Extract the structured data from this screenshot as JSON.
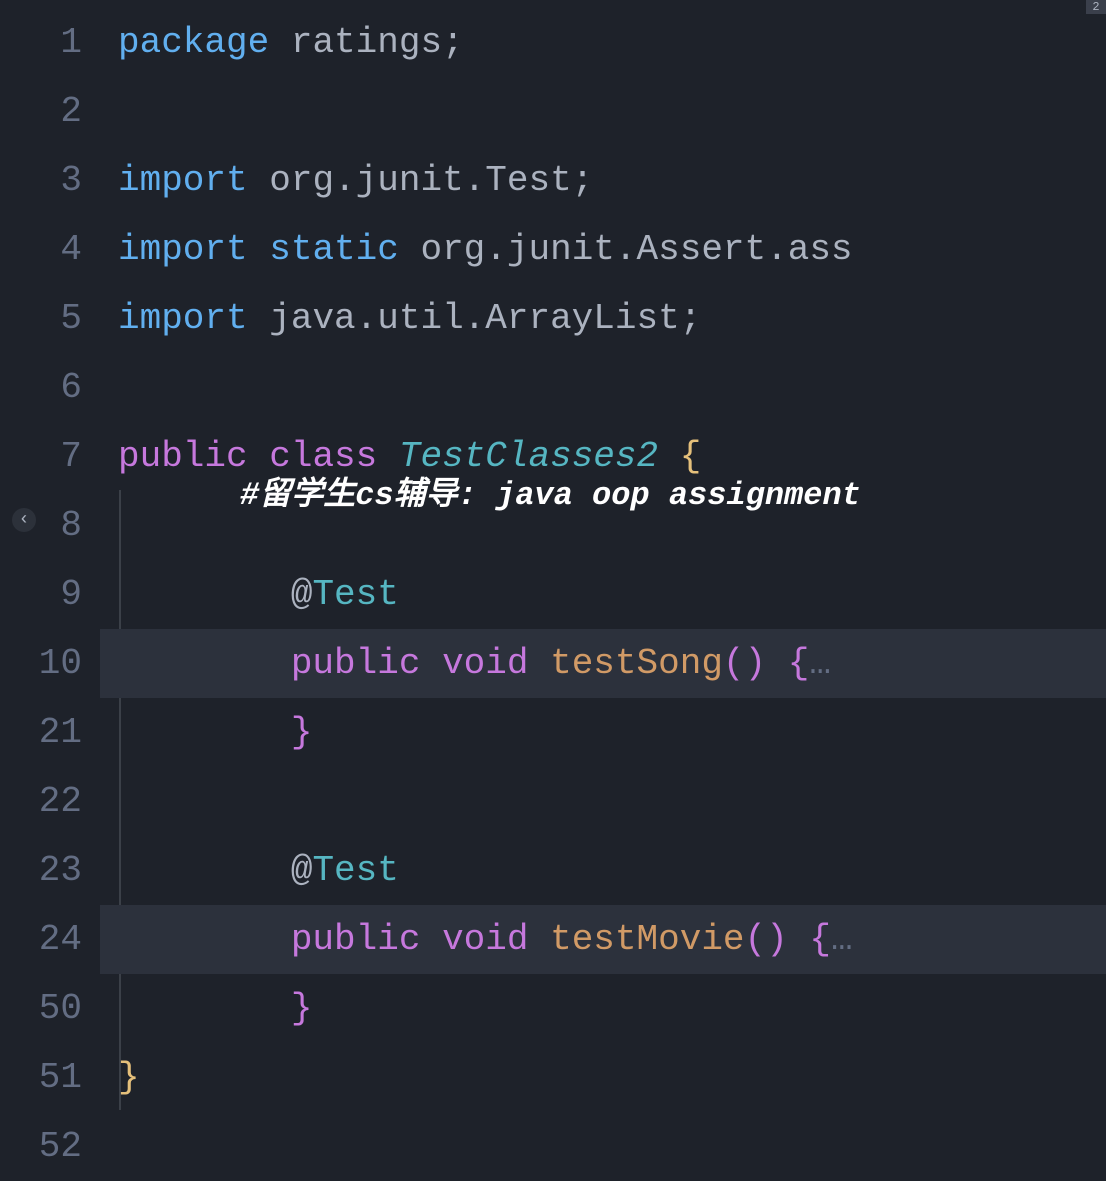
{
  "lines": [
    {
      "num": "1",
      "tokens": [
        {
          "t": "package",
          "c": "kw-blue"
        },
        {
          "t": " ",
          "c": "ident"
        },
        {
          "t": "ratings",
          "c": "ident"
        },
        {
          "t": ";",
          "c": "punct"
        }
      ]
    },
    {
      "num": "2",
      "tokens": []
    },
    {
      "num": "3",
      "tokens": [
        {
          "t": "import",
          "c": "kw-blue"
        },
        {
          "t": " ",
          "c": "ident"
        },
        {
          "t": "org.junit.Test",
          "c": "ident"
        },
        {
          "t": ";",
          "c": "punct"
        }
      ]
    },
    {
      "num": "4",
      "tokens": [
        {
          "t": "import",
          "c": "kw-blue"
        },
        {
          "t": " ",
          "c": "ident"
        },
        {
          "t": "static",
          "c": "kw-blue"
        },
        {
          "t": " ",
          "c": "ident"
        },
        {
          "t": "org.junit.Assert.ass",
          "c": "ident"
        }
      ]
    },
    {
      "num": "5",
      "tokens": [
        {
          "t": "import",
          "c": "kw-blue"
        },
        {
          "t": " ",
          "c": "ident"
        },
        {
          "t": "java.util.ArrayList",
          "c": "ident"
        },
        {
          "t": ";",
          "c": "punct"
        }
      ]
    },
    {
      "num": "6",
      "tokens": []
    },
    {
      "num": "7",
      "tokens": [
        {
          "t": "public",
          "c": "kw"
        },
        {
          "t": " ",
          "c": "ident"
        },
        {
          "t": "class",
          "c": "kw"
        },
        {
          "t": " ",
          "c": "ident"
        },
        {
          "t": "TestClasses2",
          "c": "classname"
        },
        {
          "t": " ",
          "c": "ident"
        },
        {
          "t": "{",
          "c": "brace-yellow"
        }
      ]
    },
    {
      "num": "8",
      "indent": 1,
      "tokens": []
    },
    {
      "num": "9",
      "indent": 2,
      "tokens": [
        {
          "t": "@",
          "c": "annotation-at"
        },
        {
          "t": "Test",
          "c": "annotation-name"
        }
      ]
    },
    {
      "num": "10",
      "indent": 2,
      "folded": true,
      "fold": ">",
      "tokens": [
        {
          "t": "public",
          "c": "kw"
        },
        {
          "t": " ",
          "c": "ident"
        },
        {
          "t": "void",
          "c": "kw"
        },
        {
          "t": " ",
          "c": "ident"
        },
        {
          "t": "testSong",
          "c": "method"
        },
        {
          "t": "(",
          "c": "paren"
        },
        {
          "t": ")",
          "c": "paren"
        },
        {
          "t": " ",
          "c": "ident"
        },
        {
          "t": "{",
          "c": "brace-pink"
        },
        {
          "t": "…",
          "c": "ellipsis"
        }
      ]
    },
    {
      "num": "21",
      "indent": 2,
      "tokens": [
        {
          "t": "}",
          "c": "brace-pink"
        }
      ]
    },
    {
      "num": "22",
      "indent": 1,
      "tokens": []
    },
    {
      "num": "23",
      "indent": 2,
      "tokens": [
        {
          "t": "@",
          "c": "annotation-at"
        },
        {
          "t": "Test",
          "c": "annotation-name"
        }
      ]
    },
    {
      "num": "24",
      "indent": 2,
      "folded": true,
      "fold": ">",
      "tokens": [
        {
          "t": "public",
          "c": "kw"
        },
        {
          "t": " ",
          "c": "ident"
        },
        {
          "t": "void",
          "c": "kw"
        },
        {
          "t": " ",
          "c": "ident"
        },
        {
          "t": "testMovie",
          "c": "method"
        },
        {
          "t": "(",
          "c": "paren"
        },
        {
          "t": ")",
          "c": "paren"
        },
        {
          "t": " ",
          "c": "ident"
        },
        {
          "t": "{",
          "c": "brace-pink"
        },
        {
          "t": "…",
          "c": "ellipsis"
        }
      ]
    },
    {
      "num": "50",
      "indent": 2,
      "tokens": [
        {
          "t": "}",
          "c": "brace-pink"
        }
      ]
    },
    {
      "num": "51",
      "indent": 0,
      "tokens": [
        {
          "t": "}",
          "c": "brace-yellow"
        }
      ]
    },
    {
      "num": "52",
      "tokens": []
    }
  ],
  "overlay": "#留学生cs辅导: java oop assignment",
  "backChevron": "‹",
  "scrollIndicator": "2"
}
